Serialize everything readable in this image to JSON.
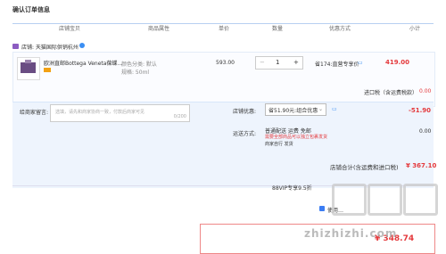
{
  "header": {
    "title": "确认订单信息"
  },
  "columns": [
    "店铺宝贝",
    "商品属性",
    "单价",
    "数量",
    "优惠方式",
    "小计"
  ],
  "shop": {
    "name": "店铺: 天猫国际供销杭州"
  },
  "item": {
    "name": "欧洲直邮Bottega Veneta葆蝶...",
    "attr1": "颜色分类: 默认",
    "attr2": "规格: 50ml",
    "price": "593.00",
    "qty": "1",
    "promo": "省174:直营专享价",
    "subtotal": "419.00"
  },
  "tax": {
    "label": "进口税（含运费税款）",
    "value": "0.00"
  },
  "message": {
    "label": "给商家留言:",
    "placeholder": "选填，请先和商家协商一致，付款后商家可见",
    "count": "0/200"
  },
  "discount": {
    "label": "店铺优惠:",
    "selected": "省51.90元:组合优惠",
    "value": "-51.90"
  },
  "shipping": {
    "label": "运送方式:",
    "line1": "普通配送 运费 免邮",
    "line2": "需要全部商品可以独立包裹发货",
    "line3": "商家自行 发货",
    "value": "0.00"
  },
  "total": {
    "label": "店铺合计(含运费和进口税)",
    "value": "¥ 367.10"
  },
  "vip": {
    "label": "88VIP专享9.5折"
  },
  "checkbox": {
    "label": "使用…"
  },
  "pay": {
    "value": "¥ 348.74"
  },
  "watermark": {
    "text": "zhizhizhi.com"
  }
}
